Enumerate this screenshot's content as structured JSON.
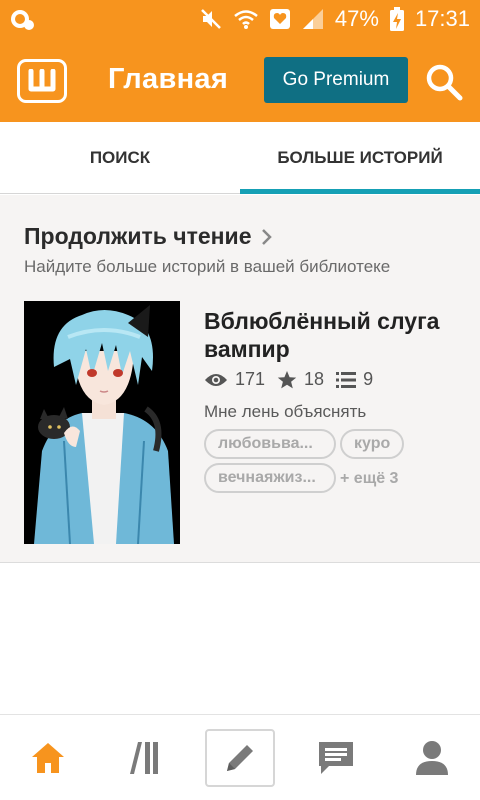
{
  "status_bar": {
    "battery": "47%",
    "time": "17:31"
  },
  "app_bar": {
    "title": "Главная",
    "premium_label": "Go Premium"
  },
  "tabs": [
    {
      "label": "ПОИСК",
      "active": false
    },
    {
      "label": "БОЛЬШЕ ИСТОРИЙ",
      "active": true
    }
  ],
  "continue_reading": {
    "title": "Продолжить чтение",
    "subtitle": "Найдите больше историй в вашей библиотеке"
  },
  "story": {
    "title": "Вблюблённый слуга вампир",
    "reads": "171",
    "votes": "18",
    "parts": "9",
    "description": "Мне лень объяснять",
    "tags": [
      "любовьва...",
      "куро",
      "вечнаяжиз..."
    ],
    "more_tags": "+ ещё 3"
  },
  "colors": {
    "brand": "#f7941e",
    "premium": "#0f6f83",
    "tab_indicator": "#15a0b5",
    "nav_active": "#f7941e",
    "nav_inactive": "#7a7a7a"
  },
  "bottom_nav": [
    {
      "icon": "home-icon",
      "active": true
    },
    {
      "icon": "library-icon",
      "active": false
    },
    {
      "icon": "pencil-icon",
      "active": false
    },
    {
      "icon": "messages-icon",
      "active": false
    },
    {
      "icon": "profile-icon",
      "active": false
    }
  ]
}
